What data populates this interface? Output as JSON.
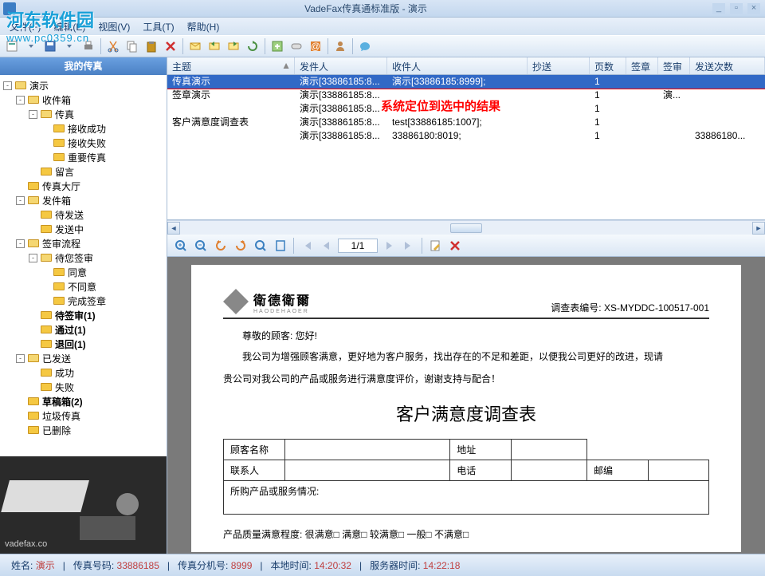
{
  "window": {
    "title": "VadeFax传真通标准版 - 演示"
  },
  "menu": {
    "file": "文件(F)",
    "edit": "编辑(E)",
    "view": "视图(V)",
    "tools": "工具(T)",
    "help": "帮助(H)"
  },
  "sidebar": {
    "title": "我的传真",
    "tree": [
      {
        "indent": 0,
        "toggle": "-",
        "icon": "root",
        "label": "演示",
        "bold": false
      },
      {
        "indent": 1,
        "toggle": "-",
        "icon": "folder",
        "label": "收件箱",
        "bold": false
      },
      {
        "indent": 2,
        "toggle": "-",
        "icon": "folder",
        "label": "传真",
        "bold": false
      },
      {
        "indent": 3,
        "toggle": "",
        "icon": "folder",
        "label": "接收成功",
        "bold": false
      },
      {
        "indent": 3,
        "toggle": "",
        "icon": "folder",
        "label": "接收失败",
        "bold": false
      },
      {
        "indent": 3,
        "toggle": "",
        "icon": "folder",
        "label": "重要传真",
        "bold": false
      },
      {
        "indent": 2,
        "toggle": "",
        "icon": "folder",
        "label": "留言",
        "bold": false
      },
      {
        "indent": 1,
        "toggle": "",
        "icon": "hall",
        "label": "传真大厅",
        "bold": false
      },
      {
        "indent": 1,
        "toggle": "-",
        "icon": "folder",
        "label": "发件箱",
        "bold": false
      },
      {
        "indent": 2,
        "toggle": "",
        "icon": "folder",
        "label": "待发送",
        "bold": false
      },
      {
        "indent": 2,
        "toggle": "",
        "icon": "folder",
        "label": "发送中",
        "bold": false
      },
      {
        "indent": 1,
        "toggle": "-",
        "icon": "sign",
        "label": "签审流程",
        "bold": false
      },
      {
        "indent": 2,
        "toggle": "-",
        "icon": "folder",
        "label": "待您签审",
        "bold": false
      },
      {
        "indent": 3,
        "toggle": "",
        "icon": "folder",
        "label": "同意",
        "bold": false
      },
      {
        "indent": 3,
        "toggle": "",
        "icon": "folder",
        "label": "不同意",
        "bold": false
      },
      {
        "indent": 3,
        "toggle": "",
        "icon": "folder",
        "label": "完成签章",
        "bold": false
      },
      {
        "indent": 2,
        "toggle": "",
        "icon": "folder",
        "label": "待签审(1)",
        "bold": true
      },
      {
        "indent": 2,
        "toggle": "",
        "icon": "folder",
        "label": "通过(1)",
        "bold": true
      },
      {
        "indent": 2,
        "toggle": "",
        "icon": "folder",
        "label": "退回(1)",
        "bold": true
      },
      {
        "indent": 1,
        "toggle": "-",
        "icon": "folder",
        "label": "已发送",
        "bold": false
      },
      {
        "indent": 2,
        "toggle": "",
        "icon": "folder",
        "label": "成功",
        "bold": false
      },
      {
        "indent": 2,
        "toggle": "",
        "icon": "folder",
        "label": "失败",
        "bold": false
      },
      {
        "indent": 1,
        "toggle": "",
        "icon": "folder",
        "label": "草稿箱(2)",
        "bold": true
      },
      {
        "indent": 1,
        "toggle": "",
        "icon": "trash",
        "label": "垃圾传真",
        "bold": false
      },
      {
        "indent": 1,
        "toggle": "",
        "icon": "deleted",
        "label": "已删除",
        "bold": false
      }
    ],
    "ad_text": "vadefax.co"
  },
  "list": {
    "columns": {
      "subject": "主题",
      "sender": "发件人",
      "recipient": "收件人",
      "cc": "抄送",
      "pages": "页数",
      "stamp": "签章",
      "review": "签审",
      "send_count": "发送次数"
    },
    "col_widths": {
      "subject": 160,
      "sender": 116,
      "recipient": 176,
      "cc": 78,
      "pages": 46,
      "stamp": 40,
      "review": 40,
      "send_count": 70
    },
    "rows": [
      {
        "subject": "传真演示",
        "sender": "演示[33886185:8...",
        "recipient": "演示[33886185:8999];",
        "cc": "",
        "pages": "1",
        "stamp": "",
        "review": "",
        "send_count": "",
        "selected": true
      },
      {
        "subject": "签章演示",
        "sender": "演示[33886185:8...",
        "recipient": "",
        "cc": "",
        "pages": "1",
        "stamp": "",
        "review": "演...",
        "send_count": ""
      },
      {
        "subject": "",
        "sender": "演示[33886185:8...",
        "recipient": "",
        "cc": "",
        "pages": "1",
        "stamp": "",
        "review": "",
        "send_count": ""
      },
      {
        "subject": "客户满意度调查表",
        "sender": "演示[33886185:8...",
        "recipient": "test[33886185:1007];",
        "cc": "",
        "pages": "1",
        "stamp": "",
        "review": "",
        "send_count": ""
      },
      {
        "subject": "",
        "sender": "演示[33886185:8...",
        "recipient": "33886180:8019;",
        "cc": "",
        "pages": "1",
        "stamp": "",
        "review": "",
        "send_count": "33886180..."
      }
    ],
    "annotation": "系统定位到选中的结果"
  },
  "preview": {
    "page_indicator": "1/1"
  },
  "document": {
    "logo_text": "衛德衛爾",
    "code_label": "调查表编号:",
    "code_value": "XS-MYDDC-100517-001",
    "greeting": "尊敬的顾客: 您好!",
    "para1": "我公司为增强顾客满意，更好地为客户服务，找出存在的不足和差距，以便我公司更好的改进，现请",
    "para2": "贵公司对我公司的产品或服务进行满意度评价，谢谢支持与配合！",
    "title": "客户满意度调查表",
    "table": {
      "cust_name": "顾客名称",
      "addr": "地址",
      "contact": "联系人",
      "phone": "电话",
      "postcode": "邮编",
      "products": "所购产品或服务情况:"
    },
    "quality_line": "产品质量满意程度:   很满意□   满意□   较满意□   一般□   不满意□"
  },
  "status": {
    "name_label": "姓名:",
    "name_value": "演示",
    "fax_label": "传真号码:",
    "fax_value": "33886185",
    "ext_label": "传真分机号:",
    "ext_value": "8999",
    "local_label": "本地时间:",
    "local_value": "14:20:32",
    "server_label": "服务器时间:",
    "server_value": "14:22:18"
  },
  "watermark": {
    "title": "河东软件园",
    "url": "www.pc0359.cn"
  }
}
